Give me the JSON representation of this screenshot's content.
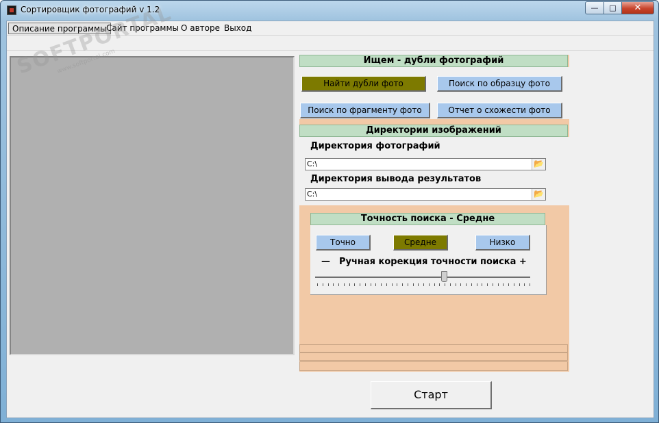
{
  "window": {
    "title": "Сортировщик фотографий v 1.2",
    "controls": {
      "minimize": "—",
      "maximize": "□",
      "close": "✕"
    }
  },
  "menu": {
    "items": [
      "Описание программы",
      "Сайт программы",
      "О авторе",
      "Выход"
    ]
  },
  "watermark": {
    "logo": "SOFTPORTAL",
    "url": "www.softportal.com"
  },
  "search_section": {
    "header": "Ищем - дубли фотографий",
    "buttons": {
      "find_duplicates": "Найти дубли фото",
      "by_sample": "Поиск по образцу фото",
      "by_fragment": "Поиск по фрагменту фото",
      "similarity_report": "Отчет о схожести фото"
    },
    "active": "find_duplicates"
  },
  "directories_section": {
    "header": "Директории изображений",
    "photo_dir_label": "Директория фотографий",
    "photo_dir_value": "C:\\",
    "output_dir_label": "Директория вывода результатов",
    "output_dir_value": "C:\\"
  },
  "accuracy_section": {
    "header": "Точность поиска - Средне",
    "buttons": {
      "exact": "Точно",
      "medium": "Средне",
      "low": "Низко"
    },
    "active": "medium",
    "manual_minus": "—",
    "manual_label": "Ручная корекция точности поиска +",
    "slider_value": 0.6
  },
  "start_button": "Старт",
  "colors": {
    "panel": "#f2c9a6",
    "header": "#c0dec4",
    "button_blue": "#a8c8ec",
    "button_active": "#7d7a00",
    "preview": "#b0b0b0"
  }
}
